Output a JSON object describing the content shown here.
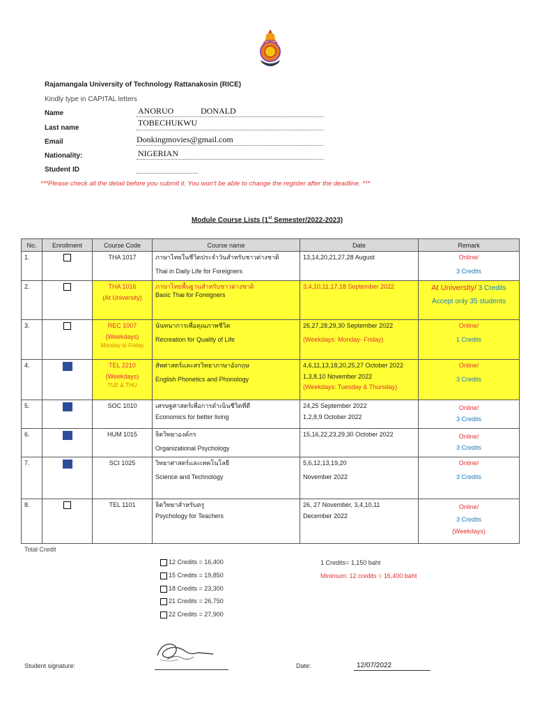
{
  "header": {
    "university": "Rajamangala University of Technology Rattanakosin (RICE)",
    "hint": "Kindly type in CAPITAL letters"
  },
  "form": {
    "name_label": "Name",
    "name_value_first": "ANORUO",
    "name_value_second": "DONALD",
    "lastname_label": "Last name",
    "lastname_value": "TOBECHUKWU",
    "email_label": "Email",
    "email_value": "Donkingmovies@gmail.com",
    "nationality_label": "Nationality:",
    "nationality_value": "NIGERIAN",
    "studentid_label": "Student ID",
    "studentid_value": ""
  },
  "warning": "***Please check all the detail before you submit it. You won't be able to change the register after the deadline. ***",
  "module_title": {
    "prefix": "Module Course Lists (1",
    "sup": "st",
    "suffix": "  Semester/2022-2023)"
  },
  "table": {
    "headers": [
      "No.",
      "Enrollment",
      "Course Code",
      "Course name",
      "Date",
      "Remark"
    ],
    "rows": [
      {
        "no": "1.",
        "enrolled": false,
        "code": "THA 1017",
        "name_th": "ภาษาไทยในชีวิตประจำวันสำหรับชาวต่างชาติ",
        "name_en": "Thai in Daily Life for Foreigners",
        "date": "13,14,20,21,27,28 August",
        "remark1": "Online/",
        "remark2": "3 Credits"
      },
      {
        "no": "2.",
        "enrolled": false,
        "code": "THA 1016",
        "code_sub": "(At University)",
        "name_th": "ภาษาไทยพื้นฐานสำหรับชาวต่างชาติ",
        "name_en": "Basic Thai for Foreigners",
        "date": "3,4,10,11,17,18 September 2022",
        "remark1": "At University/",
        "remark1b": " 3 Credits",
        "remark2": "Accept only 35 students"
      },
      {
        "no": "3.",
        "enrolled": false,
        "code": "REC 1007",
        "code_sub": "(Weekdays)",
        "code_sub2": "Monday to Friday",
        "name_th": "นันทนาการเพื่อคุณภาพชีวิต",
        "name_en": "Recreation for Quality of Life",
        "date": "26,27,28,29,30 September 2022",
        "date2": "(Weekdays: Monday- Friday)",
        "remark1": "Online/",
        "remark2": "1 Credits"
      },
      {
        "no": "4.",
        "enrolled": true,
        "code": "TEL 2210",
        "code_sub": "(Weekdays)",
        "code_sub2": "TUE & THU",
        "name_th": "สัทศาสตร์และสรวิทยาภาษาอังกฤษ",
        "name_en": "English Phonetics and Phonology",
        "date": "4,6,11,13,18,20,25,27 October 2022",
        "date2": "1,3,8,10 November 2022",
        "date3": "(Weekdays: Tuesday & Thursday)",
        "remark1": "Online/",
        "remark2": "3 Credits"
      },
      {
        "no": "5.",
        "enrolled": true,
        "code": "SOC 1010",
        "name_th": "เศรษฐศาสตร์เพื่อการดำเนินชีวิตที่ดี",
        "name_en": "Economics for better living",
        "date": "24,25 September 2022",
        "date2": "1,2,8,9 October 2022",
        "remark1": "Online/",
        "remark2": "3 Credits"
      },
      {
        "no": "6.",
        "enrolled": true,
        "code": "HUM 1015",
        "name_th": "จิตวิทยาองค์กร",
        "name_en": "Organizational Psychology",
        "date": "15,16,22,23,29,30 October 2022",
        "remark1": "Online/",
        "remark2": "3 Credits"
      },
      {
        "no": "7.",
        "enrolled": true,
        "code": "SCI 1025",
        "name_th": "วิทยาศาสตร์และเทคโนโลยี",
        "name_en": "Science and Technology",
        "date": "5,6,12,13,19,20",
        "date2": "November 2022",
        "remark1": "Online/",
        "remark2": "3 Credits"
      },
      {
        "no": "8.",
        "enrolled": false,
        "code": "TEL 1101",
        "name_th": "จิตวิทยาสำหรับครู",
        "name_en": "Psychology for Teachers",
        "date": "26, 27 November, 3,4,10,11",
        "date2": "December 2022",
        "remark1": "Online/",
        "remark2": "3 Credits",
        "remark3": "(Weekdays)"
      }
    ]
  },
  "total_credit_label": "Total Credit",
  "credit_options": [
    "12 Credits  = 16,400",
    "15 Credits = 19,850",
    "18 Credits = 23,300",
    "21 Credits = 26,750",
    "22 Credits = 27,900"
  ],
  "credit_rate": "1 Credits= 1,150 baht",
  "credit_minimum": "Minimum: 12 credits = 16,400 baht",
  "footer": {
    "signature_label": "Student signature:",
    "date_label": "Date:",
    "date_value": "12/07/2022"
  },
  "colors": {
    "highlight": "#ffff33",
    "red": "#e03131",
    "blue": "#1e7ab8",
    "orange": "#e07b00",
    "checkbox_filled": "#2e4d99"
  }
}
